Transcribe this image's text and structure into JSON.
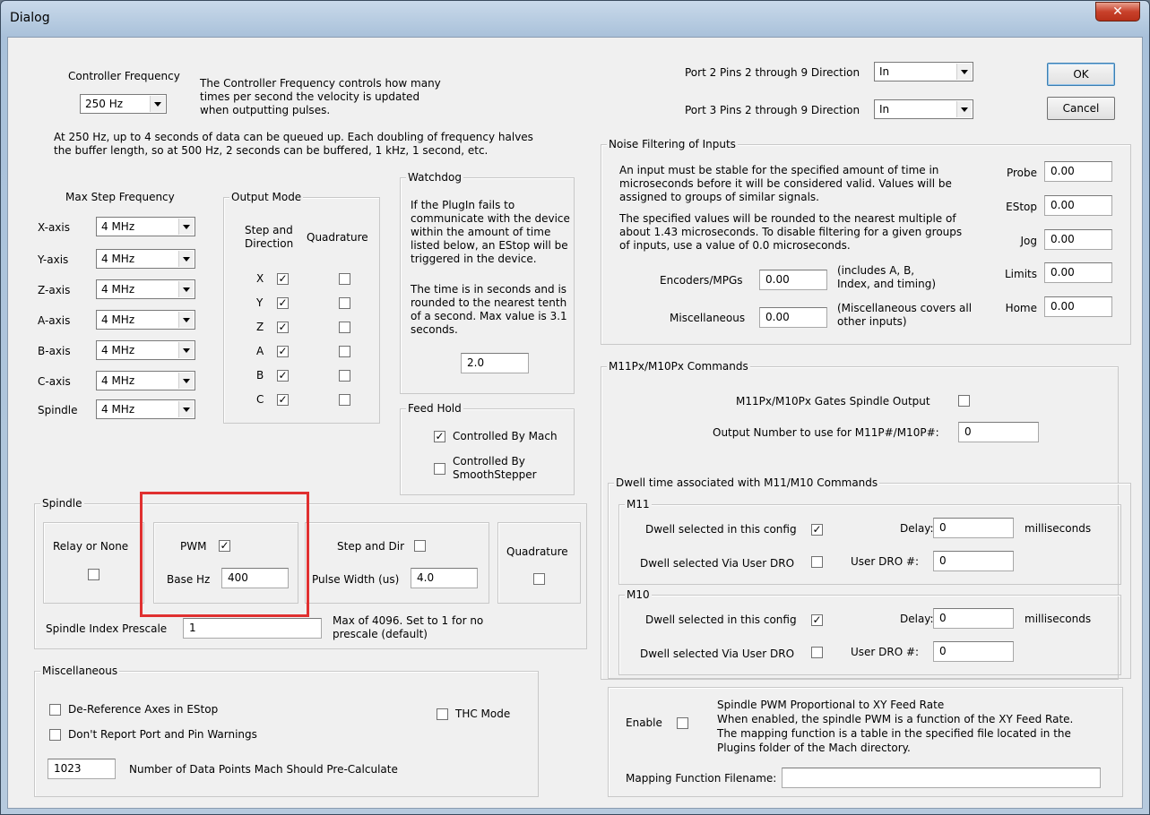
{
  "window": {
    "title": "Dialog",
    "close_icon": "x-icon"
  },
  "buttons": {
    "ok": "OK",
    "cancel": "Cancel"
  },
  "controller": {
    "label": "Controller Frequency",
    "value": "250 Hz",
    "desc": [
      "The Controller Frequency controls how many",
      "times per second the velocity is updated",
      "when outputting pulses."
    ],
    "note": [
      "At 250 Hz, up to 4 seconds of data can be queued up.  Each doubling of frequency halves",
      "the buffer length, so at 500 Hz, 2 seconds can be buffered, 1 kHz, 1 second, etc."
    ]
  },
  "max_step": {
    "label": "Max Step Frequency",
    "axes": [
      {
        "name": "X-axis",
        "value": "4 MHz"
      },
      {
        "name": "Y-axis",
        "value": "4 MHz"
      },
      {
        "name": "Z-axis",
        "value": "4 MHz"
      },
      {
        "name": "A-axis",
        "value": "4 MHz"
      },
      {
        "name": "B-axis",
        "value": "4 MHz"
      },
      {
        "name": "C-axis",
        "value": "4 MHz"
      },
      {
        "name": "Spindle",
        "value": "4 MHz"
      }
    ]
  },
  "output_mode": {
    "title": "Output Mode",
    "col1": [
      "Step and",
      "Direction"
    ],
    "col2": "Quadrature",
    "rows": [
      {
        "axis": "X",
        "step": true,
        "quad": false
      },
      {
        "axis": "Y",
        "step": true,
        "quad": false
      },
      {
        "axis": "Z",
        "step": true,
        "quad": false
      },
      {
        "axis": "A",
        "step": true,
        "quad": false
      },
      {
        "axis": "B",
        "step": true,
        "quad": false
      },
      {
        "axis": "C",
        "step": true,
        "quad": false
      }
    ]
  },
  "watchdog": {
    "title": "Watchdog",
    "text1": [
      "If the PlugIn fails to",
      "communicate with the device",
      "within the amount of time",
      "listed below, an EStop will be",
      "triggered in the device."
    ],
    "text2": [
      "The time is in seconds and is",
      "rounded to the nearest tenth",
      "of a second.  Max value is 3.1",
      "seconds."
    ],
    "value": "2.0"
  },
  "feed_hold": {
    "title": "Feed Hold",
    "opt1": "Controlled By Mach",
    "opt1_checked": true,
    "opt2": [
      "Controlled By",
      "SmoothStepper"
    ],
    "opt2_checked": false
  },
  "spindle": {
    "title": "Spindle",
    "relay": "Relay or None",
    "pwm": "PWM",
    "pwm_checked": true,
    "base_hz_label": "Base Hz",
    "base_hz": "400",
    "step_dir": "Step and Dir",
    "pulse_width_label": "Pulse Width (us)",
    "pulse_width": "4.0",
    "quadrature": "Quadrature",
    "index_prescale_label": "Spindle Index Prescale",
    "index_prescale": "1",
    "prescale_note": [
      "Max of 4096. Set to 1 for no",
      "prescale (default)"
    ]
  },
  "misc": {
    "title": "Miscellaneous",
    "deref": "De-Reference Axes in EStop",
    "no_warn": "Don't Report Port and Pin Warnings",
    "thc": "THC Mode",
    "points": "1023",
    "points_label": "Number of Data Points Mach Should Pre-Calculate"
  },
  "ports": {
    "p2_label": "Port 2 Pins 2 through 9 Direction",
    "p2_value": "In",
    "p3_label": "Port 3 Pins 2 through 9 Direction",
    "p3_value": "In"
  },
  "noise": {
    "title": "Noise Filtering of Inputs",
    "text1": [
      "An input must be stable for the specified amount of time in",
      "microseconds before it will be considered valid.  Values will be",
      "assigned to groups of similar signals."
    ],
    "text2": [
      "The specified values will be rounded to the nearest multiple of",
      "about 1.43 microseconds.  To disable filtering for a given groups",
      "of inputs, use a value of 0.0 microseconds."
    ],
    "encoders_label": "Encoders/MPGs",
    "encoders": "0.00",
    "encoders_note": [
      "(includes A, B,",
      "Index, and timing)"
    ],
    "misc_label": "Miscellaneous",
    "misc": "0.00",
    "misc_note": [
      "(Miscellaneous covers all",
      "other inputs)"
    ],
    "fields": [
      {
        "label": "Probe",
        "value": "0.00"
      },
      {
        "label": "EStop",
        "value": "0.00"
      },
      {
        "label": "Jog",
        "value": "0.00"
      },
      {
        "label": "Limits",
        "value": "0.00"
      },
      {
        "label": "Home",
        "value": "0.00"
      }
    ]
  },
  "m11": {
    "title": "M11Px/M10Px Commands",
    "gates": "M11Px/M10Px Gates Spindle Output",
    "output_label": "Output Number to use for M11P#/M10P#:",
    "output": "0",
    "dwell_title": "Dwell time associated with M11/M10 Commands",
    "groups": [
      {
        "name": "M11",
        "config": "Dwell selected in this config",
        "config_checked": true,
        "dro": "Dwell selected Via User DRO",
        "delay_label": "Delay:",
        "delay": "0",
        "ms": "milliseconds",
        "dro_label": "User DRO #:",
        "dro_value": "0"
      },
      {
        "name": "M10",
        "config": "Dwell selected in this config",
        "config_checked": true,
        "dro": "Dwell selected Via User DRO",
        "delay_label": "Delay:",
        "delay": "0",
        "ms": "milliseconds",
        "dro_label": "User DRO #:",
        "dro_value": "0"
      }
    ]
  },
  "pwm_feed": {
    "enable": "Enable",
    "text": [
      "Spindle PWM Proportional to XY Feed Rate",
      "When enabled, the spindle PWM is a function of the XY Feed Rate.",
      "The mapping function is a table in the specified file located in the",
      "Plugins folder of the Mach directory."
    ],
    "filename_label": "Mapping Function Filename:",
    "filename": ""
  }
}
